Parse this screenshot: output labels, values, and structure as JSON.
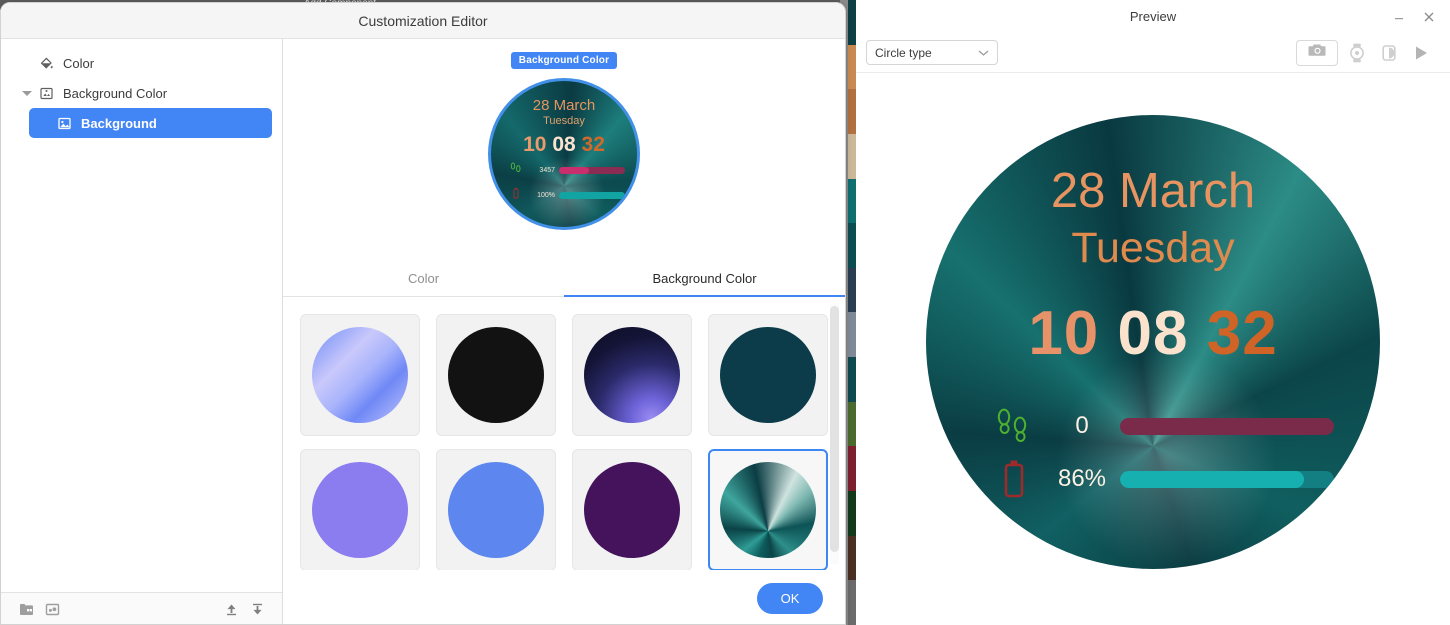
{
  "background_app": {
    "title": "Add Component",
    "thumb_colors": [
      "#0d3f45",
      "#c98a52",
      "#b07040",
      "#cbb79a",
      "#0e6e70",
      "#0d4d52",
      "#2a3d52",
      "#7f8a97",
      "#0f4a50",
      "#4a6a2e",
      "#7d1f2e",
      "#123a1a",
      "#4a2f22",
      "#6b6b6b"
    ]
  },
  "editor": {
    "title": "Customization Editor",
    "sidebar": {
      "items": [
        {
          "label": "Color",
          "icon": "paint-bucket-icon",
          "selected": false,
          "expandable": false,
          "indent": 0
        },
        {
          "label": "Background Color",
          "icon": "image-grid-icon",
          "selected": false,
          "expandable": true,
          "indent": 0
        },
        {
          "label": "Background",
          "icon": "image-icon",
          "selected": true,
          "expandable": false,
          "indent": 1
        }
      ],
      "footer_icons": [
        "add-folder-icon",
        "add-image-icon",
        "move-up-icon",
        "move-down-icon"
      ]
    },
    "mini_preview": {
      "badge_label": "Background Color",
      "date": "28 March",
      "day": "Tuesday",
      "hours": "10",
      "minutes": "08",
      "seconds": "32",
      "steps_value": "3457",
      "steps_percent": 45,
      "battery_value": "100%",
      "battery_percent": 100
    },
    "tabs": [
      {
        "label": "Color",
        "active": false
      },
      {
        "label": "Background Color",
        "active": true
      }
    ],
    "swatches": [
      {
        "name": "blue-diagonal-gradient",
        "selected": false,
        "css": "linear-gradient(135deg, #6e8bf7 0%, #c9c8fb 34%, #a9b4fb 52%, #6f88f6 70%, #c4c6fb 100%)"
      },
      {
        "name": "black-solid",
        "selected": false,
        "css": "#121212"
      },
      {
        "name": "navy-violet-gradient",
        "selected": false,
        "css": "radial-gradient(circle at 70% 95%, #9a8cf2 0%, #6d63d8 18%, #2b2a6a 48%, #141437 72%, #0b0b22 100%)"
      },
      {
        "name": "dark-teal-solid",
        "selected": false,
        "css": "#0c3c49"
      },
      {
        "name": "violet-solid",
        "selected": false,
        "css": "#8b7cf0"
      },
      {
        "name": "royal-blue-solid",
        "selected": false,
        "css": "#5d86ef"
      },
      {
        "name": "dark-purple-solid",
        "selected": false,
        "css": "#44135c"
      },
      {
        "name": "teal-conic-metal",
        "selected": true,
        "css": "conic-gradient(from 200deg at 50% 72%, #0e5e5f 0deg, #2f9c95 32deg, #0a4347 74deg, #3fa69d 112deg, #0b3d44 148deg, #cfe3df 186deg, #7fb9b2 206deg, #0d5356 240deg, #2e8f8a 292deg, #0b4448 330deg, #0e5e5f 360deg)"
      }
    ],
    "ok_label": "OK"
  },
  "preview": {
    "title": "Preview",
    "window_buttons": [
      "minimize-icon",
      "close-icon"
    ],
    "type_select_value": "Circle type",
    "actions": [
      "camera-icon",
      "watch-icon",
      "contrast-icon",
      "play-icon"
    ],
    "watch_face": {
      "date": "28 March",
      "day": "Tuesday",
      "hours": "10",
      "minutes": "08",
      "seconds": "32",
      "steps_value": "0",
      "steps_percent": 0,
      "battery_value": "86%",
      "battery_percent": 86
    }
  },
  "colors": {
    "accent": "#4285f4",
    "date_text": "#e89460",
    "minutes_text": "#fbe2cd",
    "seconds_text": "#cf6426",
    "steps_bar": "#7a2b4a",
    "battery_bar": "#147f83"
  }
}
